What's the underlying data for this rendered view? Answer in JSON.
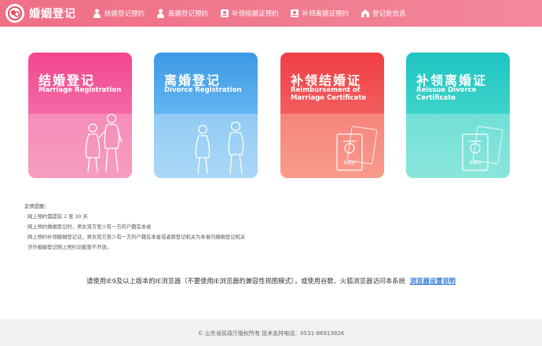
{
  "header": {
    "logo_text": "婚姻登记",
    "nav": [
      {
        "label": "结婚登记预约",
        "icon": "person-icon"
      },
      {
        "label": "离婚登记预约",
        "icon": "person-icon"
      },
      {
        "label": "补领结婚证预约",
        "icon": "certificate-icon"
      },
      {
        "label": "补领离婚证预约",
        "icon": "certificate-icon"
      },
      {
        "label": "登记处信息",
        "icon": "home-icon"
      }
    ],
    "colors": {
      "bar": "#ef6f86"
    }
  },
  "cards": [
    {
      "title": "结婚登记",
      "subtitle": "Marriage Registration",
      "color": "#f2478f"
    },
    {
      "title": "离婚登记",
      "subtitle": "Divorce Registration",
      "color": "#3c9ae6"
    },
    {
      "title": "补领结婚证",
      "subtitle": "Reimbursement of Marriage Certificate",
      "color": "#ef3e45",
      "cert_label": "结婚证"
    },
    {
      "title": "补领离婚证",
      "subtitle": "Reissue Divorce Certificate",
      "color": "#1ec4c0",
      "cert_label": "离婚证"
    }
  ],
  "tips": {
    "heading": "友情提醒：",
    "items": [
      "· 网上预约需提前 2 至 30 天",
      "· 网上预约婚姻登记时，男女双方至少有一方的户籍在本省",
      "· 网上预约补领婚姻登记证，男女双方至少有一方的户籍在本省或者原登记机关为本省内婚姻登记机关",
      "· 涉外婚姻登记网上预约功能暂不开放。"
    ]
  },
  "notice": {
    "text": "请使用IE9及以上版本的IE浏览器（不要使用IE浏览器的兼容性视图模式），或使用谷歌、火狐浏览器访问本系统",
    "link": "浏览器设置说明"
  },
  "footer": {
    "text": "© 山东省民政厅版权所有    技术支持电话：0531-86913826"
  }
}
